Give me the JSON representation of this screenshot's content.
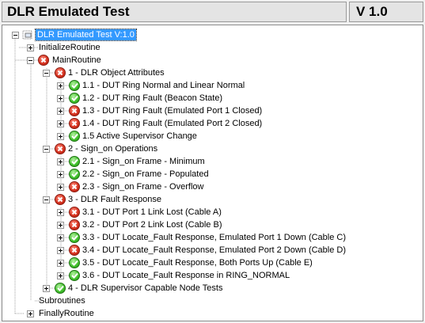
{
  "header": {
    "title": "DLR Emulated Test",
    "version": "V 1.0"
  },
  "tree": {
    "root": "DLR Emulated Test V:1.0",
    "initialize": "InitializeRoutine",
    "main": "MainRoutine",
    "group1": "1 - DLR Object Attributes",
    "g1_items": [
      "1.1 - DUT Ring Normal and Linear Normal",
      "1.2 - DUT Ring Fault (Beacon State)",
      "1.3 - DUT Ring Fault (Emulated Port 1 Closed)",
      "1.4 - DUT Ring Fault (Emulated Port 2 Closed)",
      "1.5 Active Supervisor Change"
    ],
    "group2": "2 - Sign_on Operations",
    "g2_items": [
      "2.1 - Sign_on Frame - Minimum",
      "2.2 - Sign_on Frame - Populated",
      "2.3 - Sign_on Frame - Overflow"
    ],
    "group3": "3 - DLR Fault Response",
    "g3_items": [
      "3.1 - DUT Port 1 Link Lost (Cable A)",
      "3.2 - DUT Port 2 Link Lost (Cable B)",
      "3.3 - DUT Locate_Fault Response, Emulated Port 1 Down (Cable C)",
      "3.4 - DUT Locate_Fault Response, Emulated Port 2 Down (Cable D)",
      "3.5 - DUT Locate_Fault Response, Both Ports Up (Cable E)",
      "3.6 - DUT Locate_Fault Response in RING_NORMAL"
    ],
    "group4": "4 - DLR Supervisor Capable Node Tests",
    "subroutines": "Subroutines",
    "finally": "FinallyRoutine"
  },
  "colors": {
    "selection": "#3399ff",
    "pass": "#3fbf2a",
    "fail": "#d4311e"
  },
  "icons": {
    "pass": "check-icon",
    "fail": "x-icon"
  }
}
